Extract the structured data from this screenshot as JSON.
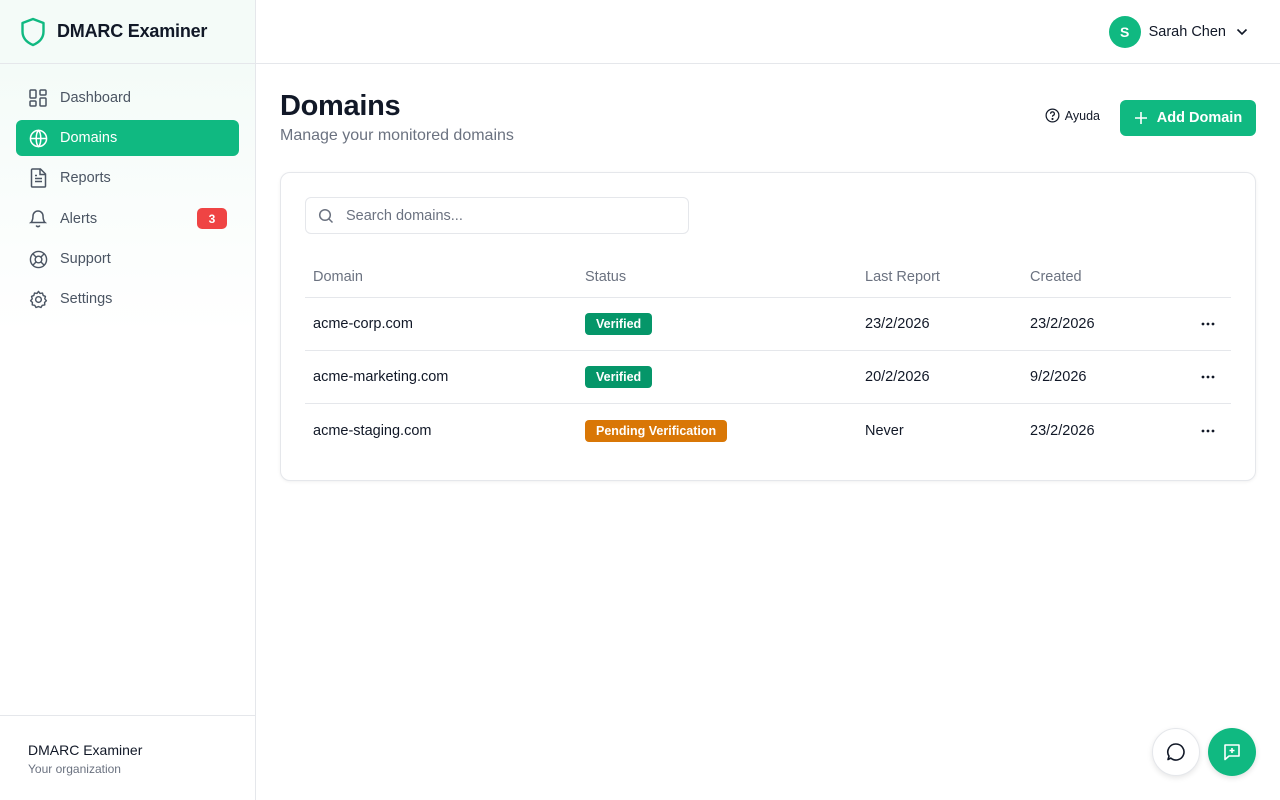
{
  "app": {
    "name": "DMARC Examiner"
  },
  "sidebar": {
    "items": [
      {
        "label": "Dashboard",
        "icon": "dashboard-icon"
      },
      {
        "label": "Domains",
        "icon": "globe-icon",
        "active": true
      },
      {
        "label": "Reports",
        "icon": "file-text-icon"
      },
      {
        "label": "Alerts",
        "icon": "bell-icon",
        "badge": "3"
      },
      {
        "label": "Support",
        "icon": "life-buoy-icon"
      },
      {
        "label": "Settings",
        "icon": "gear-icon"
      }
    ],
    "footer": {
      "org_name": "DMARC Examiner",
      "org_sub": "Your organization"
    }
  },
  "header": {
    "user": {
      "initial": "S",
      "name": "Sarah Chen"
    }
  },
  "page": {
    "title": "Domains",
    "subtitle": "Manage your monitored domains",
    "help_label": "Ayuda",
    "add_label": "Add Domain"
  },
  "search": {
    "placeholder": "Search domains...",
    "value": ""
  },
  "table": {
    "columns": [
      "Domain",
      "Status",
      "Last Report",
      "Created"
    ],
    "rows": [
      {
        "domain": "acme-corp.com",
        "status": "Verified",
        "status_type": "verified",
        "last_report": "23/2/2026",
        "created": "23/2/2026"
      },
      {
        "domain": "acme-marketing.com",
        "status": "Verified",
        "status_type": "verified",
        "last_report": "20/2/2026",
        "created": "9/2/2026"
      },
      {
        "domain": "acme-staging.com",
        "status": "Pending Verification",
        "status_type": "pending",
        "last_report": "Never",
        "created": "23/2/2026"
      }
    ]
  },
  "colors": {
    "accent": "#10b981",
    "verified": "#059669",
    "pending": "#d97706",
    "badge": "#ef4444"
  }
}
